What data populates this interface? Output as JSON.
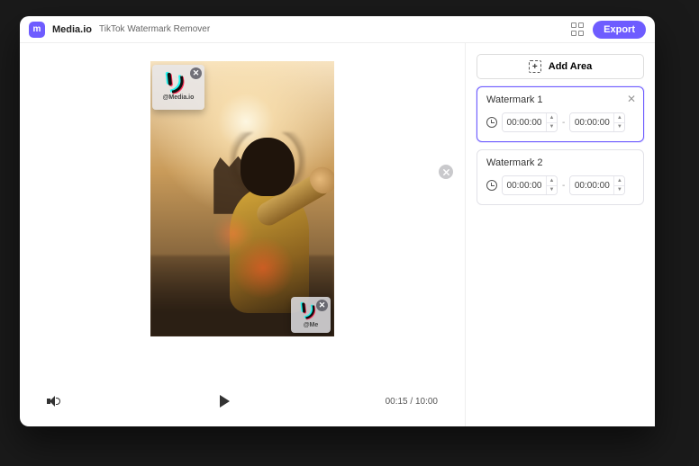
{
  "header": {
    "logo_text": "m",
    "brand": "Media.io",
    "page_title": "TikTok Watermark Remover",
    "export_label": "Export"
  },
  "add_area_label": "Add Area",
  "watermarks": [
    {
      "title": "Watermark 1",
      "start": "00:00:00",
      "end": "00:00:00",
      "handle": "@Media.io",
      "active": true
    },
    {
      "title": "Watermark 2",
      "start": "00:00:00",
      "end": "00:00:00",
      "handle": "@Me",
      "active": false
    }
  ],
  "time_dash": "-",
  "player": {
    "current": "00:15",
    "separator": " / ",
    "total": "10:00"
  },
  "colors": {
    "accent": "#6e5cff"
  }
}
